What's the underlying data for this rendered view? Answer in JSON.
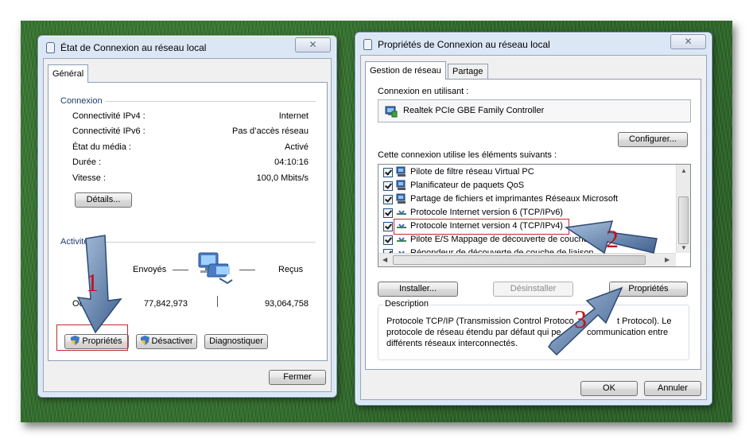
{
  "win1": {
    "title": "État de Connexion au réseau local",
    "tab_general": "Général",
    "section_connexion": "Connexion",
    "rows": [
      {
        "label": "Connectivité IPv4 :",
        "value": "Internet"
      },
      {
        "label": "Connectivité IPv6 :",
        "value": "Pas d’accès réseau"
      },
      {
        "label": "État du média :",
        "value": "Activé"
      },
      {
        "label": "Durée :",
        "value": "04:10:16"
      },
      {
        "label": "Vitesse :",
        "value": "100,0 Mbits/s"
      }
    ],
    "details_button": "Détails...",
    "section_activite": "Activité",
    "sent_label": "Envoyés",
    "received_label": "Reçus",
    "octets_label": "Octe",
    "sent_value": "77,842,973",
    "received_value": "93,064,758",
    "properties_button": "Propriétés",
    "disable_button": "Désactiver",
    "diagnose_button": "Diagnostiquer",
    "close_button": "Fermer"
  },
  "win2": {
    "title": "Propriétés de Connexion au réseau local",
    "tab_network": "Gestion de réseau",
    "tab_sharing": "Partage",
    "connect_using_label": "Connexion en utilisant :",
    "adapter_name": "Realtek PCIe GBE Family Controller",
    "configure_button": "Configurer...",
    "items_label": "Cette connexion utilise les éléments suivants :",
    "items": [
      {
        "text": "Pilote de filtre réseau Virtual PC",
        "icon": "network-client-icon"
      },
      {
        "text": "Planificateur de paquets QoS",
        "icon": "network-service-icon"
      },
      {
        "text": "Partage de fichiers et imprimantes Réseaux Microsoft",
        "icon": "network-service-icon"
      },
      {
        "text": "Protocole Internet version 6 (TCP/IPv6)",
        "icon": "protocol-icon"
      },
      {
        "text": "Protocole Internet version 4 (TCP/IPv4)",
        "icon": "protocol-icon"
      },
      {
        "text": "Pilote E/S Mappage de découverte de couche li",
        "icon": "protocol-icon"
      },
      {
        "text": "Répondeur de découverte de couche de liaison",
        "icon": "protocol-icon"
      }
    ],
    "install_button": "Installer...",
    "uninstall_button": "Désinstaller",
    "properties_button": "Propriétés",
    "description_label": "Description",
    "description_lines": [
      "Protocole TCP/IP (Transmission Control Protoco",
      "t Protocol). Le",
      "protocole de réseau étendu par défaut qui pe",
      "communication entre",
      "différents réseaux interconnectés."
    ],
    "ok_button": "OK",
    "cancel_button": "Annuler"
  },
  "annotations": {
    "step1": "1",
    "step2": "2",
    "step3": "3"
  },
  "colors": {
    "annotation_red": "#c0121b",
    "arrow_blue": "#5d7fa8"
  }
}
